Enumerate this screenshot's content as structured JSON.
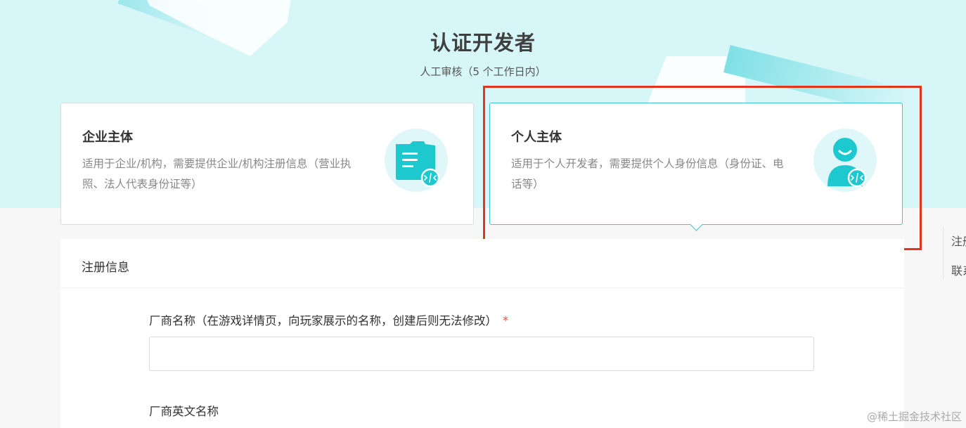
{
  "header": {
    "title": "认证开发者",
    "subtitle": "人工审核（5 个工作日内）"
  },
  "cards": [
    {
      "title": "企业主体",
      "description": "适用于企业/机构，需要提供企业/机构注册信息（营业执照、法人代表身份证等）",
      "icon": "document-code-icon",
      "selected": false
    },
    {
      "title": "个人主体",
      "description": "适用于个人开发者，需要提供个人身份信息（身份证、电话等）",
      "icon": "person-code-icon",
      "selected": true
    }
  ],
  "form": {
    "section_title": "注册信息",
    "fields": [
      {
        "label": "厂商名称（在游戏详情页，向玩家展示的名称，创建后则无法修改）",
        "required_mark": "*",
        "value": ""
      },
      {
        "label": "厂商英文名称",
        "value": ""
      }
    ]
  },
  "side_nav": {
    "items": [
      "注册信息",
      "联系方式"
    ]
  },
  "watermark": "@稀土掘金技术社区",
  "colors": {
    "accent": "#1dc8cf",
    "highlight": "#e0361c",
    "hero_bg": "#d6f6f8"
  }
}
